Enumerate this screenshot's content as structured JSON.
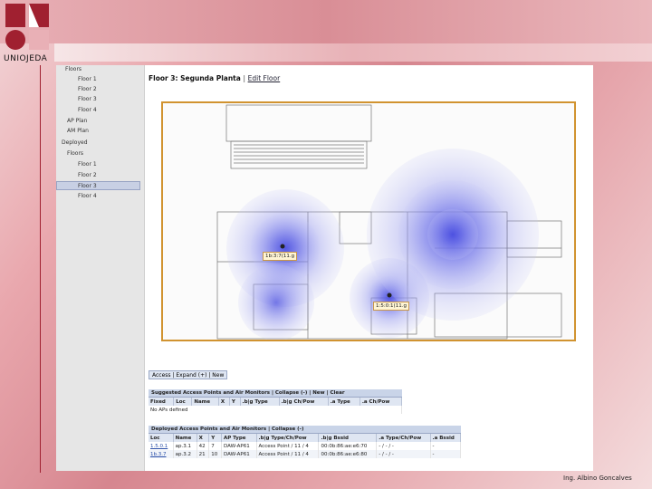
{
  "branding": {
    "logo_text": "UNIOJEDA",
    "credit": "Ing. Albino Goncalves",
    "accent": "#a02030"
  },
  "sidebar": {
    "items": [
      {
        "label": "Floors"
      },
      {
        "label": "Floor 1"
      },
      {
        "label": "Floor 2"
      },
      {
        "label": "Floor 3"
      },
      {
        "label": "Floor 4"
      },
      {
        "label": "AP Plan"
      },
      {
        "label": "AM Plan"
      },
      {
        "label": "Deployed"
      },
      {
        "label": "Floors"
      },
      {
        "label": "Floor 1"
      },
      {
        "label": "Floor 2"
      },
      {
        "label": "Floor 3"
      },
      {
        "label": "Floor 4"
      }
    ]
  },
  "header": {
    "title": "Floor 3: Segunda Planta",
    "separator": "|",
    "edit_link": "Edit Floor"
  },
  "map": {
    "ap_labels": [
      "1b:3:7(11.g",
      "1:5:0:1(11.g"
    ],
    "coverage_color": "#6b6fe8",
    "frame_color": "#d19330"
  },
  "tabs": {
    "label": "Access | Expand (+) | New"
  },
  "suggested": {
    "heading": "Suggested Access Points and Air Monitors | Collapse (-) | New | Clear",
    "columns": [
      "Fixed",
      "Loc",
      "Name",
      "X",
      "Y",
      ".b|g Type",
      ".b|g Ch/Pow",
      ".a Type",
      ".a Ch/Pow"
    ],
    "empty_text": "No APs defined"
  },
  "deployed": {
    "heading": "Deployed Access Points and Air Monitors | Collapse (-)",
    "columns": [
      "Loc",
      "Name",
      "X",
      "Y",
      "AP Type",
      ".b|g Type/Ch/Pow",
      ".b|g Bssid",
      ".a Type/Ch/Pow",
      ".a Bssid"
    ],
    "rows": [
      {
        "loc": "1.5.0.1",
        "name": "ap.3.1",
        "x": "42",
        "y": "7",
        "ap_type": "DAW-AP61",
        "bg_type": "Access Point / 11 / 4",
        "bg_bssid": "00:0b:86:ae:e6:70",
        "a_type": "- / - / -",
        "a_bssid": "-"
      },
      {
        "loc": "1b.3.7",
        "name": "ap.3.2",
        "x": "21",
        "y": "10",
        "ap_type": "DAW-AP61",
        "bg_type": "Access Point / 11 / 4",
        "bg_bssid": "00:0b:86:ae:e6:80",
        "a_type": "- / - / -",
        "a_bssid": "-"
      }
    ]
  }
}
